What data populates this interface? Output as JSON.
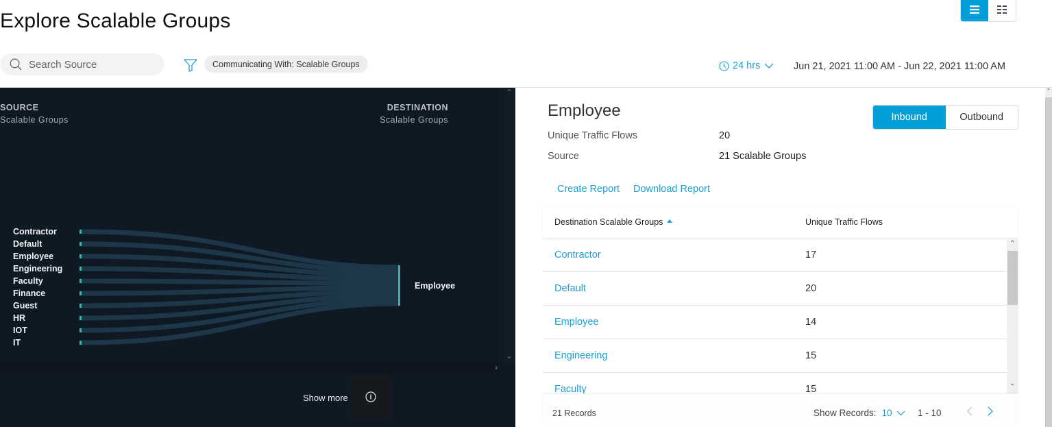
{
  "page": {
    "title": "Explore Scalable Groups"
  },
  "view_toggle": {
    "list_icon": "list-view-icon",
    "grid_icon": "grid-view-icon",
    "active": "list"
  },
  "search": {
    "placeholder": "Search Source",
    "value": "",
    "icon": "search-icon"
  },
  "filter": {
    "icon": "filter-icon",
    "chip_label": "Communicating With: Scalable Groups"
  },
  "time": {
    "icon": "clock-icon",
    "range_label": "24 hrs",
    "date_range": "Jun 21, 2021 11:00 AM - Jun 22, 2021 11:00 AM"
  },
  "sankey": {
    "source_title": "SOURCE",
    "source_subtitle": "Scalable Groups",
    "destination_title": "DESTINATION",
    "destination_subtitle": "Scalable Groups",
    "sources": [
      "Contractor",
      "Default",
      "Employee",
      "Engineering",
      "Faculty",
      "Finance",
      "Guest",
      "HR",
      "IOT",
      "IT"
    ],
    "destination": "Employee",
    "show_more_label": "Show more",
    "colors": {
      "node": "#3fb3a3",
      "link": "#1f3b4d",
      "background": "#0f1924"
    }
  },
  "details": {
    "title": "Employee",
    "unique_flows_label": "Unique Traffic Flows",
    "unique_flows_value": "20",
    "source_label": "Source",
    "source_value": "21  Scalable Groups",
    "direction": {
      "inbound_label": "Inbound",
      "outbound_label": "Outbound",
      "active": "inbound"
    },
    "create_report_label": "Create Report",
    "download_report_label": "Download Report"
  },
  "table": {
    "columns": [
      "Destination Scalable Groups",
      "Unique Traffic Flows"
    ],
    "sort_column": "Destination Scalable Groups",
    "sort_direction": "ascending",
    "rows": [
      {
        "name": "Contractor",
        "flows": "17"
      },
      {
        "name": "Default",
        "flows": "20"
      },
      {
        "name": "Employee",
        "flows": "14"
      },
      {
        "name": "Engineering",
        "flows": "15"
      },
      {
        "name": "Faculty",
        "flows": "15"
      }
    ],
    "footer": {
      "records_label": "21 Records",
      "show_records_label": "Show Records:",
      "page_size": "10",
      "page_range": "1 - 10"
    }
  },
  "colors": {
    "accent": "#049fd9",
    "link": "#1d9ecf",
    "dark_panel": "#0f1924"
  }
}
